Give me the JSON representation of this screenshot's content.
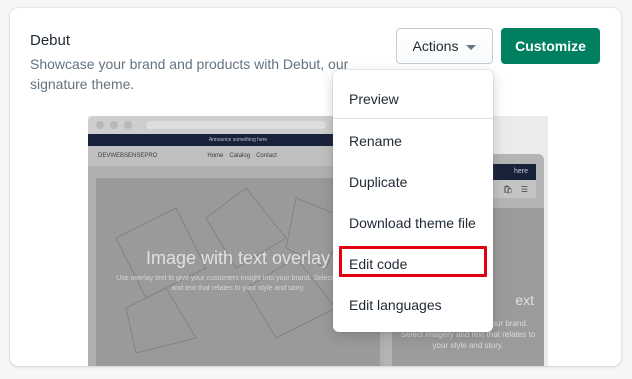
{
  "theme": {
    "name": "Debut",
    "description": "Showcase your brand and products with Debut, our signature theme."
  },
  "header_buttons": {
    "actions_label": "Actions",
    "customize_label": "Customize"
  },
  "preview": {
    "announcement": "Announce something here",
    "store_name": "DEVWEBSENSEPRO",
    "nav_links": [
      "Home",
      "Catalog",
      "Contact"
    ],
    "hero_title": "Image with text overlay",
    "hero_text": "Use overlay text to give your customers insight into your brand. Select imagery and text that relates to your style and story.",
    "mobile_announcement": "here",
    "mobile_hero_title": "ext",
    "mobile_hero_text": "customers insight into your brand. Select imagery and text that relates to your style and story."
  },
  "menu": {
    "items": [
      "Preview",
      "Rename",
      "Duplicate",
      "Download theme file",
      "Edit code",
      "Edit languages"
    ]
  },
  "colors": {
    "primary_button": "#008060",
    "highlight_box": "#e0000f"
  }
}
